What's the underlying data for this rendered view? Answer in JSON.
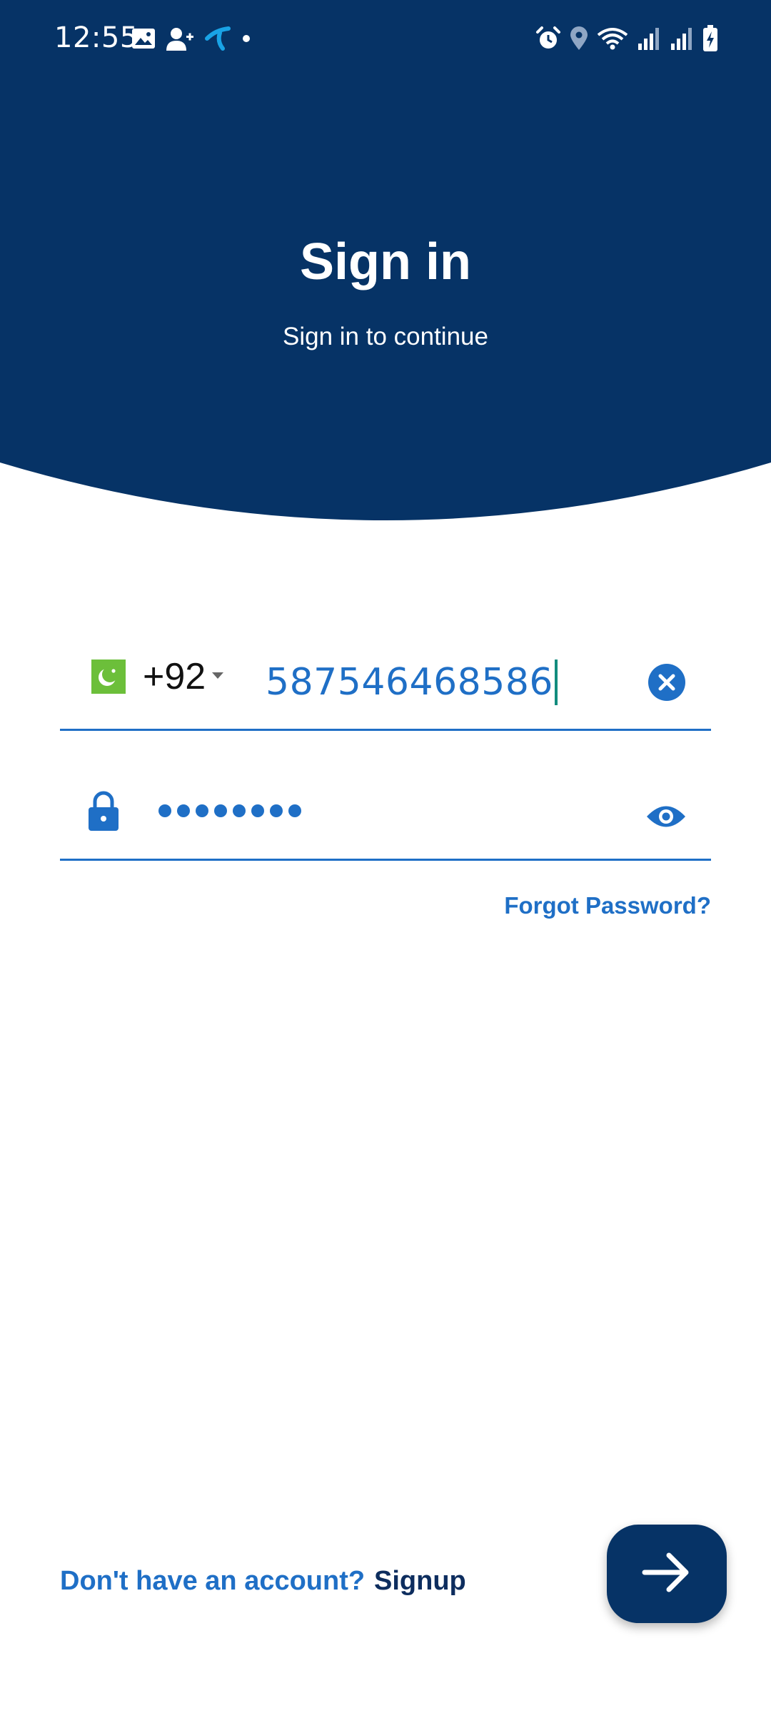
{
  "colors": {
    "brand_navy": "#063366",
    "accent_blue": "#1f6fc6",
    "flag_green": "#6cbf3a",
    "cursor_teal": "#128c7e"
  },
  "status_bar": {
    "time": "12:55",
    "left_icons": [
      "gallery-icon",
      "person-add-icon",
      "carrier-logo-icon",
      "notification-dot-icon"
    ],
    "right_icons": [
      "alarm-icon",
      "location-icon",
      "wifi-icon",
      "signal-icon",
      "signal-icon",
      "battery-charging-icon"
    ]
  },
  "header": {
    "title": "Sign in",
    "subtitle": "Sign in to continue"
  },
  "phone": {
    "flag_icon": "pakistan-flag-icon",
    "country_code": "+92",
    "value": "587546468586",
    "clear_icon": "clear-icon"
  },
  "password": {
    "lock_icon": "lock-icon",
    "masked_length": 8,
    "toggle_icon": "eye-icon"
  },
  "forgot_password": "Forgot Password?",
  "footer": {
    "no_account_text": "Don't have an account?",
    "signup_label": "Signup",
    "next_icon": "arrow-right-icon"
  }
}
